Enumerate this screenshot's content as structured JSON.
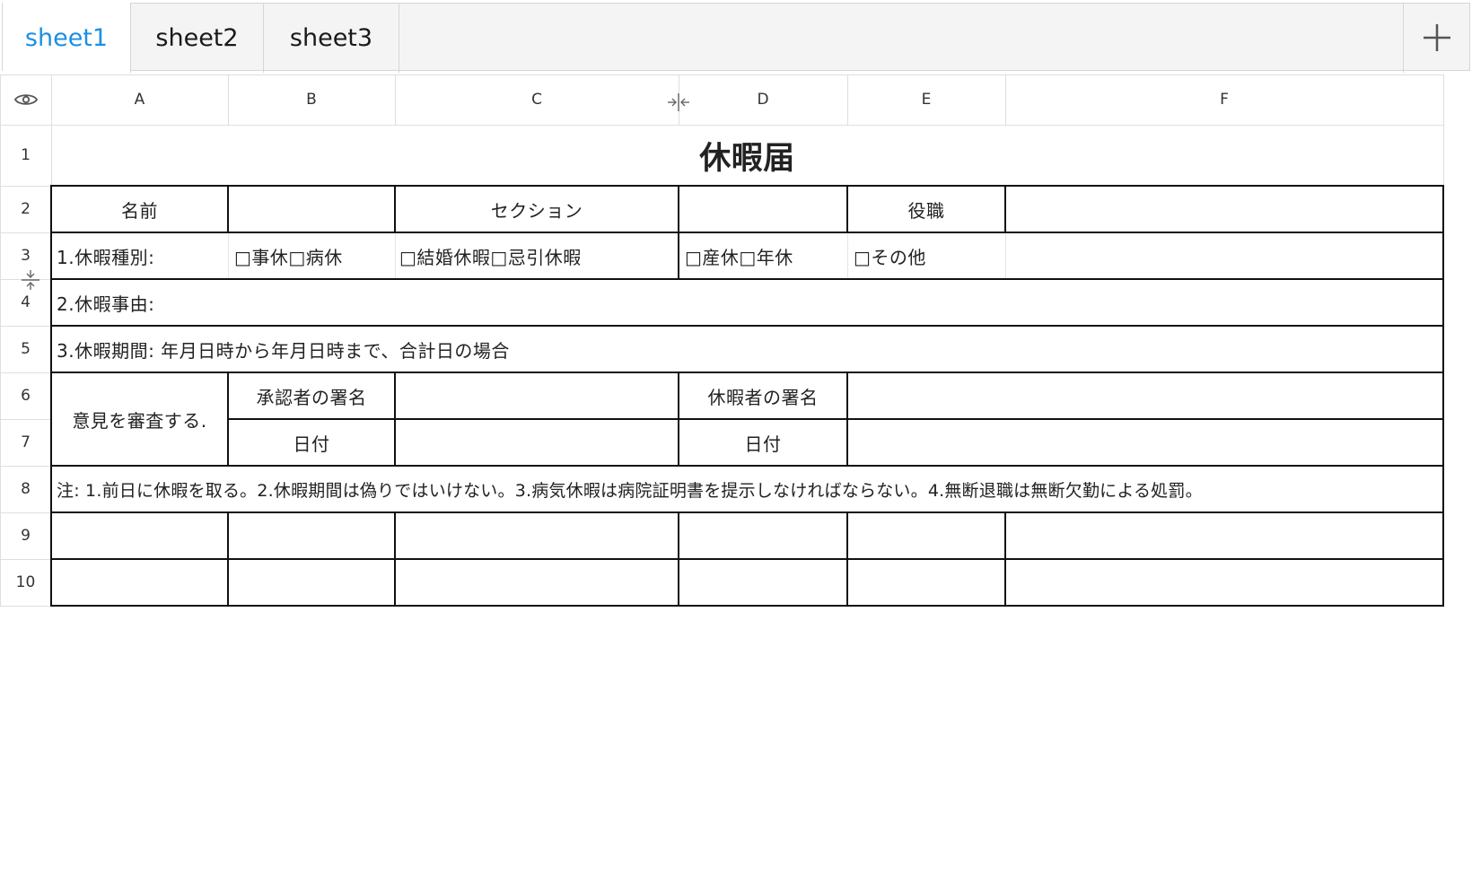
{
  "tabs": [
    {
      "label": "sheet1",
      "active": true
    },
    {
      "label": "sheet2",
      "active": false
    },
    {
      "label": "sheet3",
      "active": false
    }
  ],
  "add_sheet_icon": "plus-icon",
  "corner_icon": "eye-icon",
  "columns": [
    "A",
    "B",
    "C",
    "D",
    "E",
    "F"
  ],
  "rows": [
    "1",
    "2",
    "3",
    "4",
    "5",
    "6",
    "7",
    "8",
    "9",
    "10"
  ],
  "cells": {
    "r1_title": "休暇届",
    "r2_name_label": "名前",
    "r2_section_label": "セクション",
    "r2_position_label": "役職",
    "r3_type_label": "1.休暇種別:",
    "r3_opt1": "□事休□病休",
    "r3_opt2": "□結婚休暇□忌引休暇",
    "r3_opt3": "□産休□年休",
    "r3_opt4": "□その他",
    "r4_reason": "2.休暇事由:",
    "r5_period": "3.休暇期間: 年月日時から年月日時まで、合計日の場合",
    "r6_review": "意見を審査する.",
    "r6_approver_sig": "承認者の署名",
    "r6_applicant_sig": "休暇者の署名",
    "r7_date1": "日付",
    "r7_date2": "日付",
    "r8_note": "注: 1.前日に休暇を取る。2.休暇期間は偽りではいけない。3.病気休暇は病院証明書を提示しなければならない。4.無断退職は無断欠勤による処罰。"
  },
  "colors": {
    "active_tab": "#1c8fe3",
    "grid_border": "#111111",
    "header_line": "#dedede"
  }
}
